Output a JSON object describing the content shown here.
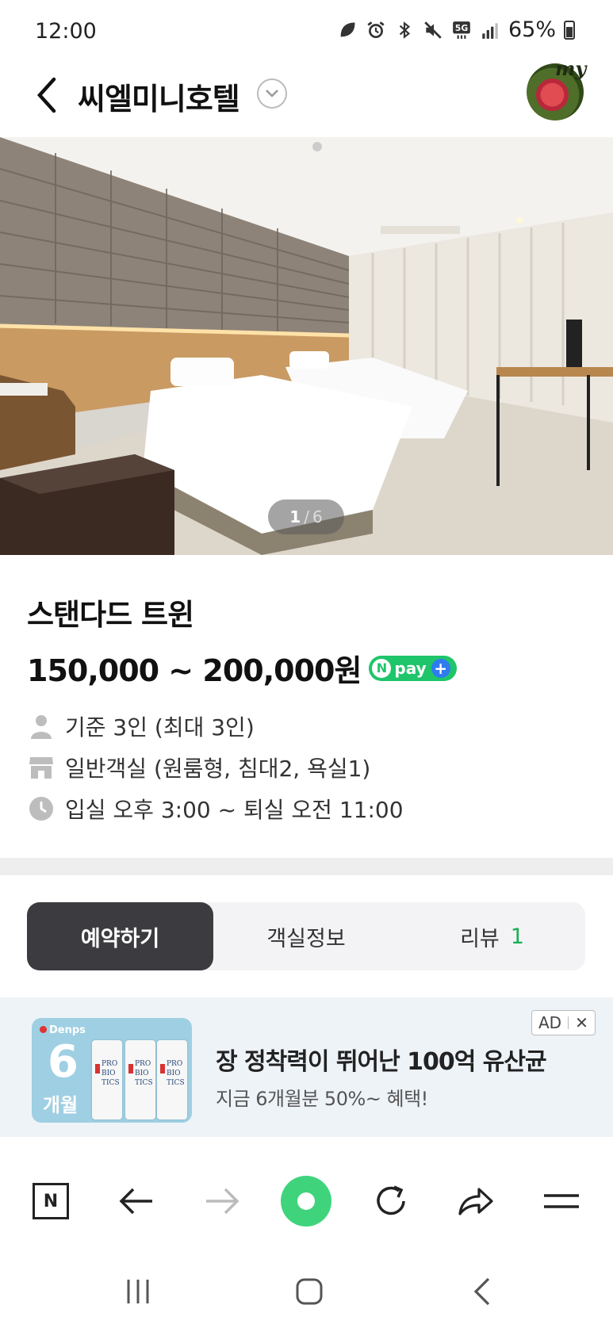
{
  "status_bar": {
    "time": "12:00",
    "network": "5G",
    "battery": "65%"
  },
  "header": {
    "title": "씨엘미니호텔",
    "avatar_label": "my"
  },
  "gallery": {
    "current": "1",
    "separator": "/",
    "total": "6"
  },
  "room": {
    "name": "스탠다드 트윈",
    "price": "150,000 ~ 200,000원",
    "npay_label": "pay",
    "npay_n": "N",
    "npay_plus": "+",
    "capacity": "기준 3인 (최대 3인)",
    "room_type": "일반객실 (원룸형, 침대2, 욕실1)",
    "check_times": "입실 오후 3:00 ~ 퇴실 오전 11:00"
  },
  "tabs": [
    {
      "label": "예약하기",
      "active": true
    },
    {
      "label": "객실정보",
      "active": false
    },
    {
      "label": "리뷰",
      "count": "1",
      "active": false
    }
  ],
  "ad": {
    "tag": "AD",
    "close": "✕",
    "brand": "Denps",
    "image_number": "6",
    "image_months": "개월",
    "headline": "장 정착력이 뛰어난 100억 유산균",
    "subline": "지금 6개월분 50%~ 혜택!"
  },
  "browser_toolbar": {
    "home_label": "N",
    "icons": [
      "naver-home-icon",
      "back-arrow-icon",
      "forward-arrow-icon",
      "green-dot-icon",
      "refresh-icon",
      "share-icon",
      "menu-icon"
    ]
  },
  "colors": {
    "accent_green": "#15b051",
    "npay_green": "#1ec56a",
    "active_tab_bg": "#3c3c40",
    "ad_bg": "#eef3f8"
  }
}
